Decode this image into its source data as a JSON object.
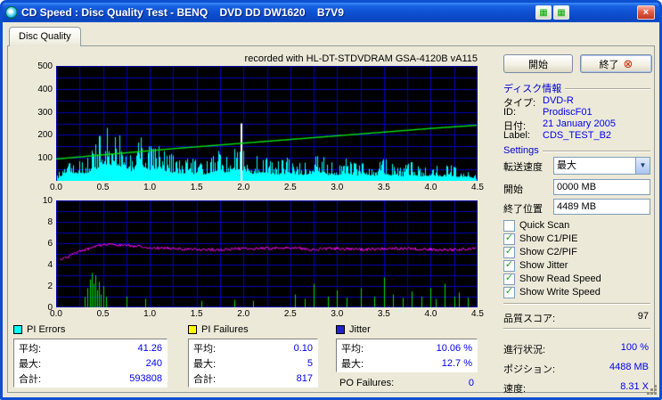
{
  "window": {
    "title": "CD Speed : Disc Quality Test - BENQ    DVD DD DW1620    B7V9"
  },
  "icons": {
    "close": "×",
    "titlebar_button": "▦",
    "dropdown_arrow": "▼",
    "check": "✓",
    "exit": "⊗"
  },
  "tab": {
    "label": "Disc Quality"
  },
  "main": {
    "recorded_with": "recorded with HL-DT-STDVDRAM GSA-4120B vA115"
  },
  "sidebar": {
    "start_button": "開始",
    "exit_button": "終了",
    "disc_info": {
      "heading": "ディスク情報",
      "rows": [
        {
          "label": "タイプ:",
          "value": "DVD-R"
        },
        {
          "label": "ID:",
          "value": "ProdiscF01"
        },
        {
          "label": "日付:",
          "value": "21 January 2005"
        },
        {
          "label": "Label:",
          "value": "CDS_TEST_B2"
        }
      ]
    },
    "settings": {
      "heading": "Settings",
      "speed_label": "転送速度",
      "speed_value": "最大",
      "start_label": "開始",
      "start_value": "0000 MB",
      "end_label": "終了位置",
      "end_value": "4489 MB",
      "checkboxes": [
        {
          "label": "Quick Scan",
          "checked": false
        },
        {
          "label": "Show C1/PIE",
          "checked": true
        },
        {
          "label": "Show C2/PIF",
          "checked": true
        },
        {
          "label": "Show Jitter",
          "checked": true
        },
        {
          "label": "Show Read Speed",
          "checked": true
        },
        {
          "label": "Show Write Speed",
          "checked": true
        }
      ]
    },
    "score": {
      "label": "品質スコア:",
      "value": "97"
    },
    "progress": [
      {
        "label": "進行状況:",
        "value": "100 %"
      },
      {
        "label": "ポジション:",
        "value": "4488 MB"
      },
      {
        "label": "速度:",
        "value": "8.31 X"
      }
    ]
  },
  "legend": {
    "pi_errors": {
      "title": "PI Errors",
      "color": "#00FFFF",
      "rows": [
        [
          "平均:",
          "41.26"
        ],
        [
          "最大:",
          "240"
        ],
        [
          "合計:",
          "593808"
        ]
      ]
    },
    "pi_failures": {
      "title": "PI Failures",
      "color": "#FFFF00",
      "rows": [
        [
          "平均:",
          "0.10"
        ],
        [
          "最大:",
          "5"
        ],
        [
          "合計:",
          "817"
        ]
      ]
    },
    "jitter": {
      "title": "Jitter",
      "color": "#2222CC",
      "rows": [
        [
          "平均:",
          "10.06 %"
        ],
        [
          "最大:",
          "12.7 %"
        ]
      ],
      "po_label": "PO Failures:",
      "po_value": "0"
    }
  },
  "chart_data": [
    {
      "name": "pi_errors_and_speed",
      "type": "area",
      "xlim": [
        0,
        4.5
      ],
      "ylim": [
        0,
        500
      ],
      "xticks": [
        "0.0",
        "0.5",
        "1.0",
        "1.5",
        "2.0",
        "2.5",
        "3.0",
        "3.5",
        "4.0",
        "4.5"
      ],
      "yticks": [
        500,
        400,
        300,
        200,
        100
      ],
      "grid_x_step": 0.25,
      "grid_y_step": 50,
      "grid_color": "#0000BB",
      "bg": "#000000",
      "seed": 20050121,
      "series": {
        "pi_errors": {
          "color": "#00FFFF",
          "x_start": 0,
          "x_step": 0.1,
          "y": [
            20,
            120,
            110,
            105,
            140,
            245,
            225,
            205,
            140,
            225,
            150,
            180,
            120,
            110,
            100,
            95,
            90,
            140,
            110,
            155,
            150,
            100,
            125,
            95,
            90,
            110,
            85,
            90,
            130,
            85,
            80,
            110,
            75,
            90,
            70,
            100,
            70,
            65,
            85,
            60,
            75,
            60,
            70,
            55,
            60,
            25
          ]
        },
        "write_speed": {
          "color": "#00E010",
          "x_start": 0,
          "x_step": 0.25,
          "y": [
            95,
            104,
            113,
            122,
            131,
            140,
            148,
            156,
            164,
            172,
            180,
            188,
            196,
            204,
            212,
            220,
            228,
            235,
            242
          ]
        },
        "marker": {
          "color": "#FFFFFF",
          "x": 1.97,
          "y_top": 250
        }
      }
    },
    {
      "name": "jitter_and_pi_failures",
      "type": "line",
      "xlim": [
        0,
        4.5
      ],
      "ylim": [
        0,
        10
      ],
      "xticks": [
        "0.0",
        "0.5",
        "1.0",
        "1.5",
        "2.0",
        "2.5",
        "3.0",
        "3.5",
        "4.0",
        "4.5"
      ],
      "yticks": [
        10,
        8,
        6,
        4,
        2,
        0
      ],
      "grid_x_step": 0.25,
      "grid_y_step": 1,
      "grid_color": "#0000BB",
      "bg": "#000000",
      "seed": 415,
      "series": {
        "jitter": {
          "color": "#FF00FF",
          "x_start": 0,
          "x_step": 0.25,
          "y": [
            4.3,
            5.2,
            5.9,
            5.8,
            5.6,
            5.5,
            5.4,
            5.4,
            5.5,
            5.5,
            5.6,
            5.4,
            5.5,
            5.4,
            5.5,
            5.5,
            5.4,
            5.4,
            5.5
          ]
        },
        "pi_failures": {
          "color": "#00DC10",
          "points": [
            [
              0.3,
              1.0
            ],
            [
              0.33,
              1.8
            ],
            [
              0.36,
              2.6
            ],
            [
              0.38,
              3.2
            ],
            [
              0.4,
              2.2
            ],
            [
              0.42,
              3.0
            ],
            [
              0.44,
              1.6
            ],
            [
              0.46,
              2.4
            ],
            [
              0.48,
              1.2
            ],
            [
              0.5,
              2.0
            ],
            [
              0.53,
              1.0
            ],
            [
              0.75,
              1.0
            ],
            [
              0.95,
              0.8
            ],
            [
              1.55,
              0.6
            ],
            [
              1.9,
              0.7
            ],
            [
              2.1,
              0.6
            ],
            [
              2.55,
              1.2
            ],
            [
              2.65,
              0.8
            ],
            [
              2.75,
              2.2
            ],
            [
              2.9,
              1.0
            ],
            [
              3.0,
              1.6
            ],
            [
              3.1,
              0.9
            ],
            [
              3.25,
              1.8
            ],
            [
              3.4,
              1.0
            ],
            [
              3.5,
              2.8
            ],
            [
              3.6,
              1.2
            ],
            [
              3.7,
              0.9
            ],
            [
              3.8,
              1.5
            ],
            [
              3.9,
              1.0
            ],
            [
              4.0,
              1.8
            ],
            [
              4.05,
              0.8
            ],
            [
              4.15,
              2.2
            ],
            [
              4.25,
              1.0
            ],
            [
              4.3,
              1.4
            ],
            [
              4.4,
              0.9
            ]
          ]
        }
      }
    }
  ]
}
